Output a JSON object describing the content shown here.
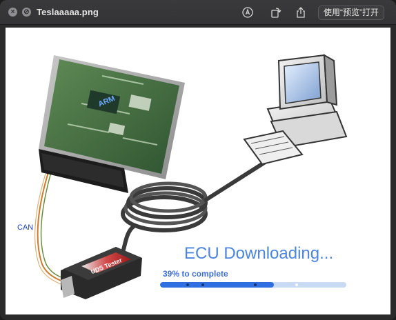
{
  "window": {
    "title": "Teslaaaaa.png",
    "open_with_label": "使用“预览”打开",
    "icons": [
      "close-icon",
      "minimize-icon",
      "markup-icon",
      "rotate-icon",
      "share-icon"
    ]
  },
  "image": {
    "can_label": "CAN",
    "device_label": "UDS Tester",
    "chip_label": "ARM",
    "headline": "ECU Downloading...",
    "progress_text": "39% to complete",
    "progress_fraction": 0.61
  },
  "colors": {
    "headline": "#4a86e0",
    "progress_fill": "#2f6fe0",
    "progress_track": "#c8daf4",
    "can_label": "#1a3fcc"
  }
}
